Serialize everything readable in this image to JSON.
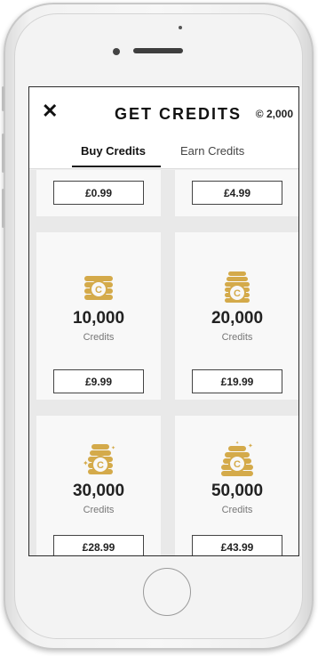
{
  "header": {
    "title": "GET CREDITS",
    "balance": "© 2,000",
    "close_symbol": "✕"
  },
  "tabs": [
    {
      "label": "Buy Credits"
    },
    {
      "label": "Earn Credits"
    }
  ],
  "packages": [
    {
      "price": "£0.99"
    },
    {
      "price": "£4.99"
    },
    {
      "amount": "10,000",
      "unit": "Credits",
      "price": "£9.99",
      "icon": "coin-stack-icon"
    },
    {
      "amount": "20,000",
      "unit": "Credits",
      "price": "£19.99",
      "icon": "coin-tall-stack-icon"
    },
    {
      "amount": "30,000",
      "unit": "Credits",
      "price": "£28.99",
      "icon": "coin-sparkle-stack-icon"
    },
    {
      "amount": "50,000",
      "unit": "Credits",
      "price": "£43.99",
      "icon": "coin-large-pile-icon"
    }
  ],
  "colors": {
    "accent": "#d4aa4a",
    "text": "#222222",
    "background": "#efefef"
  }
}
